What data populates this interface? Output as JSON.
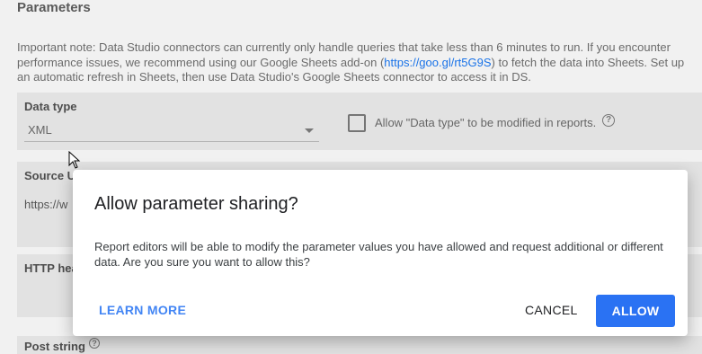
{
  "section": {
    "title": "Parameters"
  },
  "note": {
    "text_before": "Important note: Data Studio connectors can currently only handle queries that take less than 6 minutes to run. If you encounter performance issues, we recommend using our Google Sheets add-on (",
    "link": "https://goo.gl/rt5G9S",
    "text_after": ") to fetch the data into Sheets. Set up an automatic refresh in Sheets, then use Data Studio's Google Sheets connector to access it in DS."
  },
  "data_type": {
    "label": "Data type",
    "value": "XML",
    "allow_label": "Allow \"Data type\" to be modified in reports."
  },
  "source": {
    "label": "Source U",
    "value": "https://w"
  },
  "http": {
    "label": "HTTP hea"
  },
  "post": {
    "label": "Post string"
  },
  "dialog": {
    "title": "Allow parameter sharing?",
    "body": "Report editors will be able to modify the parameter values you have allowed and request additional or different data. Are you sure you want to allow this?",
    "learn_more": "LEARN MORE",
    "cancel": "CANCEL",
    "allow": "ALLOW"
  },
  "icons": {
    "help": "help-circle-icon",
    "dropdown": "chevron-down-icon",
    "cursor": "mouse-pointer-icon"
  }
}
